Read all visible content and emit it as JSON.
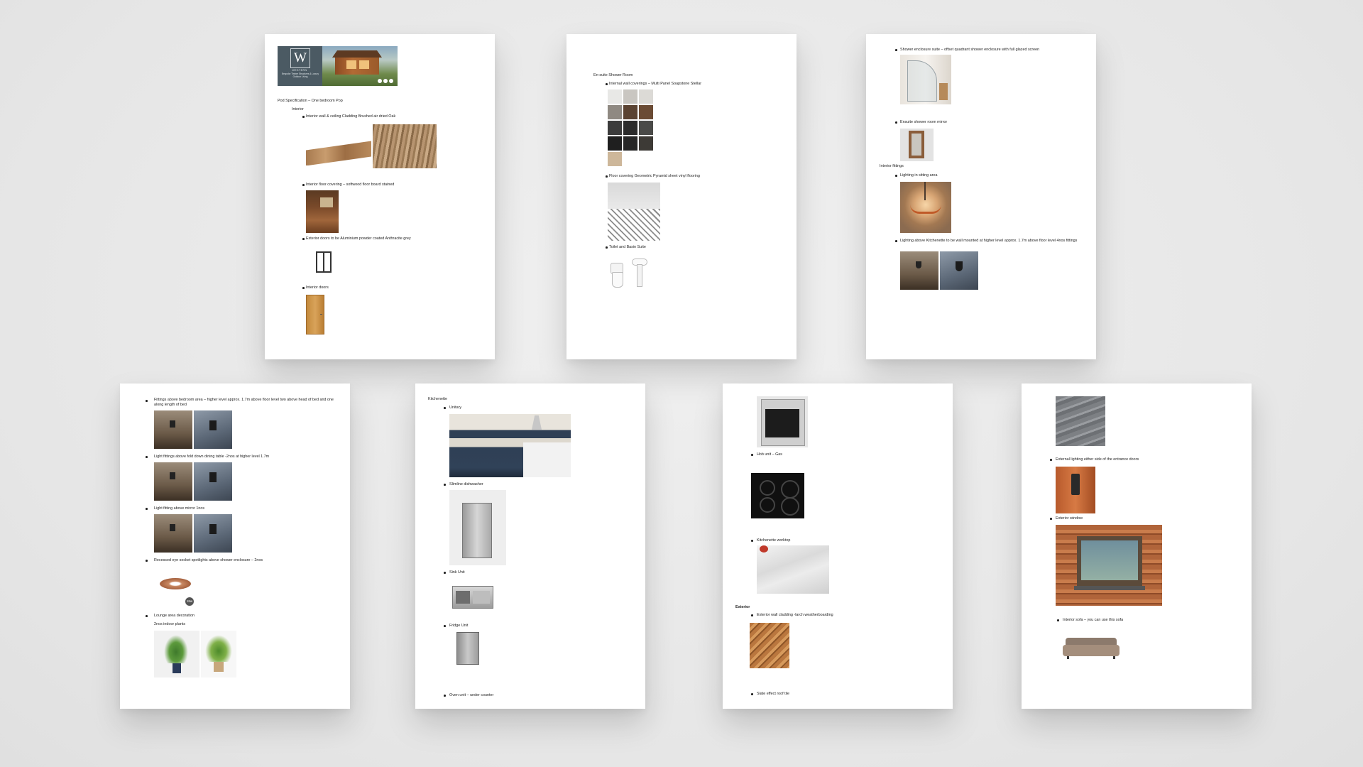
{
  "p1": {
    "logo": {
      "brand": "W",
      "name": "WESTERN",
      "sub": "Bespoke Timber Structures & Luxury Outdoor Living"
    },
    "heading": "Pod Specification – One bedroom Pop",
    "section": "Interior",
    "items": [
      "Interior wall & ceiling Cladding Brushed air dried Oak",
      "Interior floor covering – softwood floor board stained",
      "Exterior doors to be Aluminium powder coated Anthracite grey",
      "Interior doors"
    ]
  },
  "p2": {
    "heading": "En-suite Shower Room",
    "items": [
      "Internal wall coverings – Multi Panel Soapstone Stellar",
      "Floor covering Geometric Pyramid sheet vinyl flooring",
      "Toilet and Basin Suite"
    ]
  },
  "p3": {
    "items_a": [
      "Shower enclosure suite – offset quadrant shower enclosure with full glazed screen",
      "Ensuite shower room mirror"
    ],
    "section": "Interior fittings",
    "items_b": [
      "Lighting in sitting area",
      "Lighting above Kitchenette to be wall mounted at higher level approx. 1.7m above floor level 4nos fittings"
    ]
  },
  "p4": {
    "items": [
      "Fittings above bedroom area – higher level approx. 1.7m above floor level two above head of bed and one along length of bed",
      "Light fittings above fold down dining table -2nos at higher level 1.7m",
      "Light fitting above mirror 1nos",
      "Recessed eye socket spotlights above shower enclosure – 2nos",
      "Lounge area decoration"
    ],
    "plants_note": "2nos indoor plants",
    "badge": "18w"
  },
  "p5": {
    "heading": "Kitchenette",
    "items": [
      "Unitary",
      "Slimline dishwasher",
      "Sink Unit",
      "Fridge Unit",
      "Oven unit – under counter"
    ]
  },
  "p6": {
    "items": [
      "Hob unit – Gas",
      "Kitchenette worktop"
    ],
    "section": "Exterior",
    "items_b": [
      "Exterior wall cladding -larch weatherboarding",
      "Slate effect roof tile"
    ]
  },
  "p7": {
    "items": [
      "External lighting either side of the entrance doors",
      "Exterior window",
      "Interior sofa – you can use this sofa"
    ]
  }
}
